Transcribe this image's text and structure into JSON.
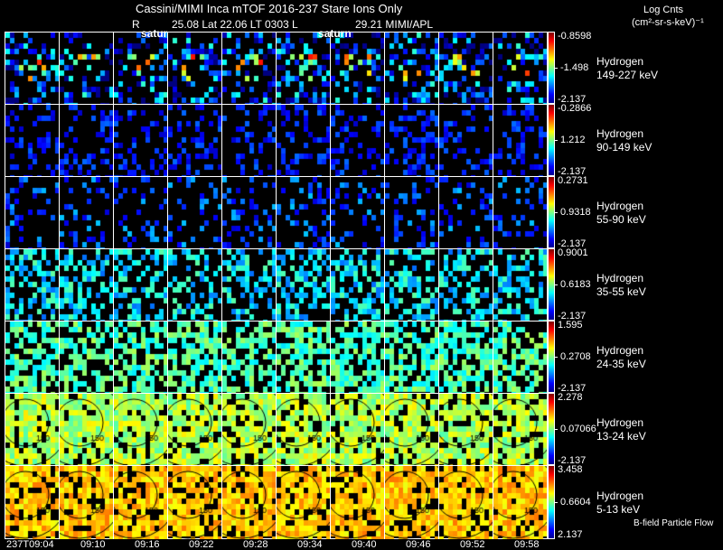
{
  "header": {
    "title": "Cassini/MIMI Inca mTOF  2016-237   Stare   Ions Only",
    "ephemeris_r": "R",
    "ephemeris": "25.08 Lat 22.06 LT 0303 L",
    "ephemeris_l": "29.21  MIMI/APL",
    "saturn_label_1": "satur",
    "saturn_label_2": "saturn"
  },
  "colorbar_title": {
    "line1": "Log Cnts",
    "line2": "(cm²-sr-s-keV)⁻¹"
  },
  "footer_note": "B-field Particle Flow",
  "chart_data": {
    "type": "heatmap",
    "title": "Cassini/MIMI Inca mTOF 2016-237 Stare Ions Only",
    "x_tick_labels": [
      "237T09:04",
      "09:10",
      "09:16",
      "09:22",
      "09:28",
      "09:34",
      "09:40",
      "09:46",
      "09:52",
      "09:58"
    ],
    "rows": [
      {
        "species": "Hydrogen",
        "energy": "149-227 keV",
        "max": "-0.8598",
        "mid": "-1.498",
        "min": "-2.137"
      },
      {
        "species": "Hydrogen",
        "energy": "90-149 keV",
        "max": "-0.2866",
        "mid": "1.212",
        "min": "-2.137"
      },
      {
        "species": "Hydrogen",
        "energy": "55-90 keV",
        "max": "0.2731",
        "mid": "0.9318",
        "min": "-2.137"
      },
      {
        "species": "Hydrogen",
        "energy": "35-55 keV",
        "max": "0.9001",
        "mid": "0.6183",
        "min": "-2.137"
      },
      {
        "species": "Hydrogen",
        "energy": "24-35 keV",
        "max": "1.595",
        "mid": "0.2708",
        "min": "-2.137"
      },
      {
        "species": "Hydrogen",
        "energy": "13-24 keV",
        "max": "2.278",
        "mid": "0.07066",
        "min": "-2.137"
      },
      {
        "species": "Hydrogen",
        "energy": "5-13 keV",
        "max": "3.458",
        "mid": "0.6604",
        "min": "2.137"
      }
    ],
    "colormap": "jet"
  }
}
